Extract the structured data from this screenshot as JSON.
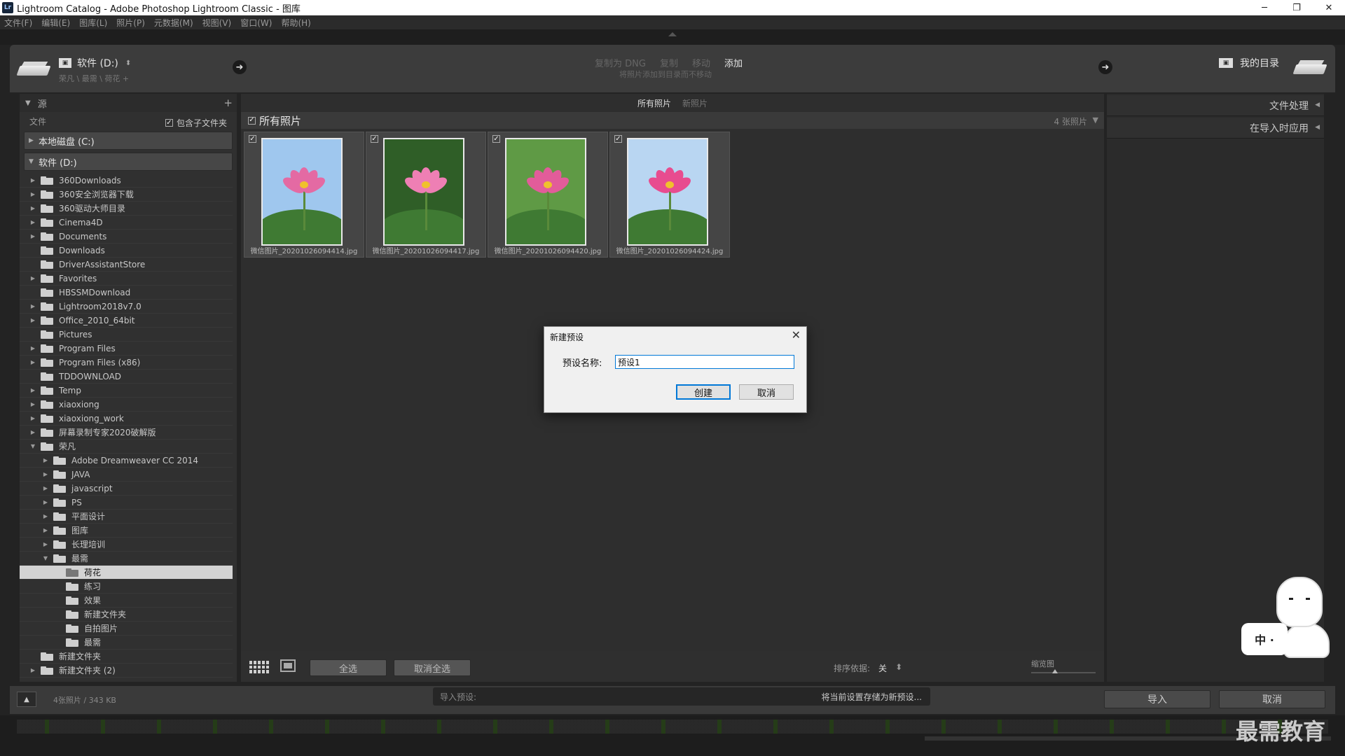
{
  "window": {
    "title": "Lightroom Catalog - Adobe Photoshop Lightroom Classic - 图库",
    "app_icon": "Lr",
    "controls": [
      "─",
      "❐",
      "✕"
    ]
  },
  "menu": [
    "文件(F)",
    "编辑(E)",
    "图库(L)",
    "照片(P)",
    "元数据(M)",
    "视图(V)",
    "窗口(W)",
    "帮助(H)"
  ],
  "header": {
    "source_device": "软件 (D:)",
    "source_path": "荣凡 \\ 最需 \\ 荷花 +",
    "modes": [
      "复制为 DNG",
      "复制",
      "移动",
      "添加"
    ],
    "active_mode": "添加",
    "mode_description": "将照片添加到目录而不移动",
    "destination": "我的目录"
  },
  "left_panel": {
    "title": "源",
    "files_label": "文件",
    "include_subfolders": "包含子文件夹",
    "volumes": [
      "本地磁盘 (C:)",
      "软件 (D:)"
    ],
    "folders": [
      {
        "name": "360Downloads",
        "level": 0,
        "expand": "▶"
      },
      {
        "name": "360安全浏览器下载",
        "level": 0,
        "expand": "▶"
      },
      {
        "name": "360驱动大师目录",
        "level": 0,
        "expand": "▶"
      },
      {
        "name": "Cinema4D",
        "level": 0,
        "expand": "▶"
      },
      {
        "name": "Documents",
        "level": 0,
        "expand": "▶"
      },
      {
        "name": "Downloads",
        "level": 0,
        "expand": ""
      },
      {
        "name": "DriverAssistantStore",
        "level": 0,
        "expand": ""
      },
      {
        "name": "Favorites",
        "level": 0,
        "expand": "▶"
      },
      {
        "name": "HBSSMDownload",
        "level": 0,
        "expand": ""
      },
      {
        "name": "Lightroom2018v7.0",
        "level": 0,
        "expand": "▶"
      },
      {
        "name": "Office_2010_64bit",
        "level": 0,
        "expand": "▶"
      },
      {
        "name": "Pictures",
        "level": 0,
        "expand": ""
      },
      {
        "name": "Program Files",
        "level": 0,
        "expand": "▶"
      },
      {
        "name": "Program Files (x86)",
        "level": 0,
        "expand": "▶"
      },
      {
        "name": "TDDOWNLOAD",
        "level": 0,
        "expand": ""
      },
      {
        "name": "Temp",
        "level": 0,
        "expand": "▶"
      },
      {
        "name": "xiaoxiong",
        "level": 0,
        "expand": "▶"
      },
      {
        "name": "xiaoxiong_work",
        "level": 0,
        "expand": "▶"
      },
      {
        "name": "屏幕录制专家2020破解版",
        "level": 0,
        "expand": "▶"
      },
      {
        "name": "荣凡",
        "level": 0,
        "expand": "▼"
      },
      {
        "name": "Adobe Dreamweaver CC 2014",
        "level": 1,
        "expand": "▶"
      },
      {
        "name": "JAVA",
        "level": 1,
        "expand": "▶"
      },
      {
        "name": "javascript",
        "level": 1,
        "expand": "▶"
      },
      {
        "name": "PS",
        "level": 1,
        "expand": "▶"
      },
      {
        "name": "平面设计",
        "level": 1,
        "expand": "▶"
      },
      {
        "name": "图库",
        "level": 1,
        "expand": "▶"
      },
      {
        "name": "长理培训",
        "level": 1,
        "expand": "▶"
      },
      {
        "name": "最需",
        "level": 1,
        "expand": "▼"
      },
      {
        "name": "荷花",
        "level": 2,
        "expand": "",
        "selected": true
      },
      {
        "name": "练习",
        "level": 2,
        "expand": ""
      },
      {
        "name": "效果",
        "level": 2,
        "expand": ""
      },
      {
        "name": "新建文件夹",
        "level": 2,
        "expand": ""
      },
      {
        "name": "自拍图片",
        "level": 2,
        "expand": ""
      },
      {
        "name": "最需",
        "level": 2,
        "expand": ""
      },
      {
        "name": "新建文件夹",
        "level": 0,
        "expand": ""
      },
      {
        "name": "新建文件夹 (2)",
        "level": 0,
        "expand": "▶"
      }
    ]
  },
  "center": {
    "tabs": [
      "所有照片",
      "新照片"
    ],
    "active_tab": "所有照片",
    "grid_title": "所有照片",
    "count": "4 张照片",
    "photos": [
      {
        "file": "微信图片_20201026094414.jpg",
        "sky": "#9fc7ee",
        "petal": "#e46aa3"
      },
      {
        "file": "微信图片_20201026094417.jpg",
        "sky": "#2f5e27",
        "petal": "#ee7fb4"
      },
      {
        "file": "微信图片_20201026094420.jpg",
        "sky": "#5f9a45",
        "petal": "#e25c9a"
      },
      {
        "file": "微信图片_20201026094424.jpg",
        "sky": "#b9d6f2",
        "petal": "#e84c8f"
      }
    ],
    "select_all": "全选",
    "deselect_all": "取消全选",
    "sort_label": "排序依据:",
    "sort_value": "关",
    "thumb_label": "缩览图"
  },
  "right_panel": {
    "sections": [
      "文件处理",
      "在导入时应用"
    ]
  },
  "bottom": {
    "summary": "4张照片 / 343 KB",
    "preset_label": "导入预设:",
    "preset_value": "将当前设置存储为新预设...",
    "import": "导入",
    "cancel": "取消"
  },
  "dialog": {
    "title": "新建预设",
    "label": "预设名称:",
    "value": "预设1",
    "create": "创建",
    "cancel": "取消"
  },
  "watermark": "最需教育",
  "mascot_text": "中 ∙"
}
